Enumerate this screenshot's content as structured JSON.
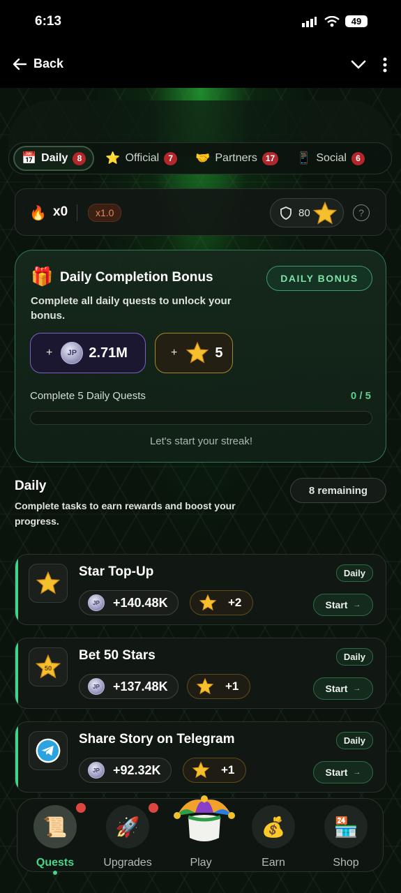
{
  "status": {
    "time": "6:13",
    "battery": "49"
  },
  "nav": {
    "back_label": "Back"
  },
  "tabs": [
    {
      "label": "Daily",
      "count": "8",
      "icon": "calendar-icon"
    },
    {
      "label": "Official",
      "count": "7",
      "icon": "star-icon"
    },
    {
      "label": "Partners",
      "count": "17",
      "icon": "handshake-icon"
    },
    {
      "label": "Social",
      "count": "6",
      "icon": "phone-icon"
    }
  ],
  "streak": {
    "count": "x0",
    "multiplier": "x1.0",
    "shield_value": "80"
  },
  "bonus": {
    "title": "Daily Completion Bonus",
    "button": "DAILY BONUS",
    "description": "Complete all daily quests to unlock your bonus.",
    "plus": "+",
    "jp_value": "2.71M",
    "star_value": "5",
    "progress_label": "Complete 5 Daily Quests",
    "progress_count": "0 / 5",
    "progress": 0,
    "footer": "Let's start your streak!"
  },
  "section": {
    "title": "Daily",
    "description": "Complete tasks to earn rewards and boost your progress.",
    "remaining": "8 remaining"
  },
  "coin_glyph": "JP",
  "quests": [
    {
      "title": "Star Top-Up",
      "badge": "Daily",
      "coins": "+140.48K",
      "stars": "+2",
      "action": "Start",
      "arrow": "→",
      "icon": "star-icon"
    },
    {
      "title": "Bet 50 Stars",
      "badge": "Daily",
      "coins": "+137.48K",
      "stars": "+1",
      "action": "Start",
      "arrow": "→",
      "icon": "star-50-icon"
    },
    {
      "title": "Share Story on Telegram",
      "badge": "Daily",
      "coins": "+92.32K",
      "stars": "+1",
      "action": "Start",
      "arrow": "→",
      "icon": "telegram-icon"
    }
  ],
  "bottom_nav": [
    {
      "label": "Quests",
      "active": true
    },
    {
      "label": "Upgrades",
      "active": false
    },
    {
      "label": "Play",
      "active": false
    },
    {
      "label": "Earn",
      "active": false
    },
    {
      "label": "Shop",
      "active": false
    }
  ],
  "colors": {
    "accent": "#46d68a",
    "badge_red": "#b3262b",
    "gold": "#f5c02e"
  }
}
